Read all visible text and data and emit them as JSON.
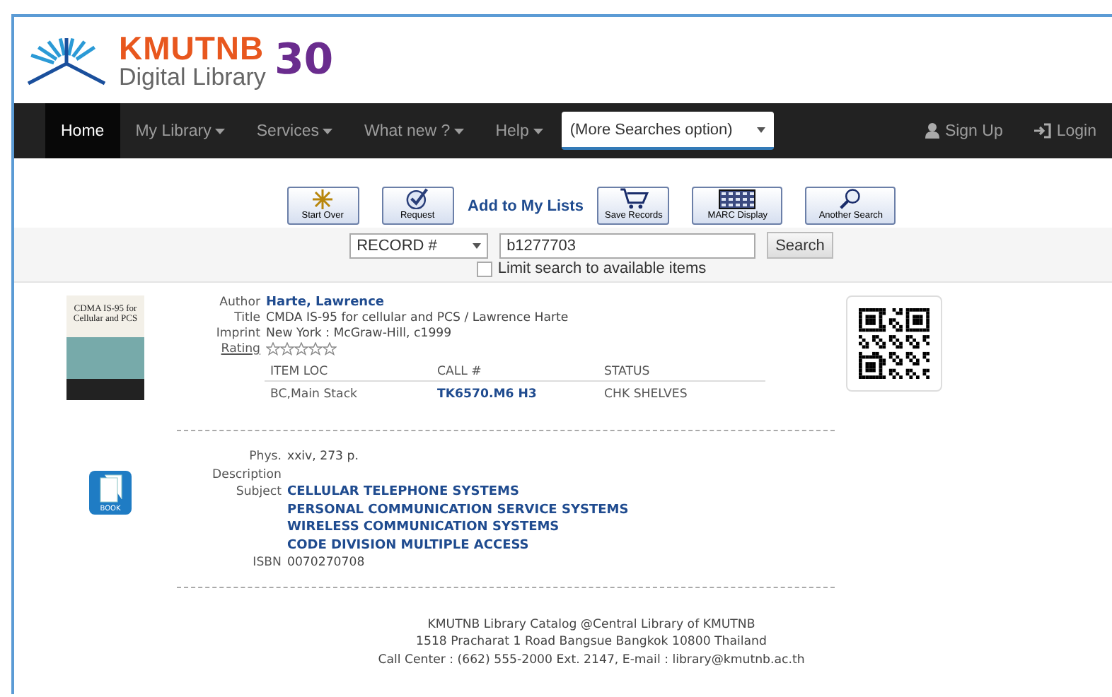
{
  "logo": {
    "name": "KMUTNB",
    "subtitle": "Digital Library",
    "badge": "30"
  },
  "nav": {
    "items": [
      {
        "label": "Home",
        "selected": true,
        "caret": false
      },
      {
        "label": "My Library",
        "selected": false,
        "caret": true
      },
      {
        "label": "Services",
        "selected": false,
        "caret": true
      },
      {
        "label": "What new ?",
        "selected": false,
        "caret": true
      },
      {
        "label": "Help",
        "selected": false,
        "caret": true
      }
    ],
    "search_select": {
      "value": "(More Searches option)"
    },
    "right": [
      {
        "kind": "signup",
        "label": "Sign Up"
      },
      {
        "kind": "login",
        "label": "Login"
      }
    ]
  },
  "toolbar": [
    {
      "kind": "start",
      "label": "Start Over"
    },
    {
      "kind": "request",
      "label": "Request"
    },
    {
      "kind": "link",
      "label": "Add to My Lists"
    },
    {
      "kind": "save",
      "label": "Save Records"
    },
    {
      "kind": "marc",
      "label": "MARC Display"
    },
    {
      "kind": "search",
      "label": "Another Search"
    }
  ],
  "search": {
    "field": "RECORD #",
    "value": "b1277703",
    "button": "Search",
    "limit": {
      "label": "Limit search to available items",
      "checked": false
    }
  },
  "record": {
    "fields": [
      {
        "label": "Author",
        "value": "Harte, Lawrence",
        "kind": "link"
      },
      {
        "label": "Title",
        "value": "CMDA IS-95 for cellular and PCS / Lawrence Harte",
        "kind": "text"
      },
      {
        "label": "Imprint",
        "value": "New York : McGraw-Hill, c1999",
        "kind": "text"
      }
    ],
    "rating": {
      "label": "Rating",
      "stars": 0
    },
    "cover": {
      "title": "CDMA IS-95 for Cellular and PCS"
    },
    "items": {
      "columns": [
        "ITEM LOC",
        "CALL #",
        "STATUS"
      ],
      "rows": [
        [
          "BC,Main Stack",
          "TK6570.M6 H3",
          "CHK SHELVES"
        ]
      ]
    },
    "details": [
      {
        "label": "Phys.",
        "values": [
          "xxiv, 273 p."
        ],
        "kind": "text"
      },
      {
        "label": "Description"
      },
      {
        "label": "Subject",
        "values": [
          "CELLULAR TELEPHONE SYSTEMS",
          "PERSONAL COMMUNICATION SERVICE SYSTEMS",
          "WIRELESS COMMUNICATION SYSTEMS",
          "CODE DIVISION MULTIPLE ACCESS"
        ],
        "kind": "link"
      },
      {
        "label": "ISBN",
        "values": [
          "0070270708"
        ],
        "kind": "text"
      }
    ],
    "format_label": "BOOK"
  },
  "footer": [
    "KMUTNB Library Catalog @Central Library of KMUTNB",
    "1518 Pracharat 1 Road Bangsue Bangkok 10800 Thailand",
    "Call Center : (662) 555-2000 Ext. 2147, E-mail : library@kmutnb.ac.th"
  ]
}
